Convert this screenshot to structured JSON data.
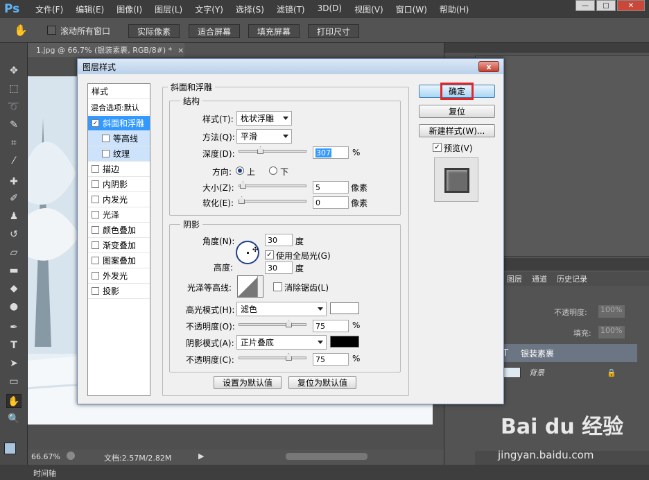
{
  "app": {
    "logo": "Ps"
  },
  "menu": [
    "文件(F)",
    "编辑(E)",
    "图像(I)",
    "图层(L)",
    "文字(Y)",
    "选择(S)",
    "滤镜(T)",
    "3D(D)",
    "视图(V)",
    "窗口(W)",
    "帮助(H)"
  ],
  "window_controls": {
    "minimize": "—",
    "maximize": "□",
    "close": "✕"
  },
  "options": {
    "scroll_all_label": "滚动所有窗口",
    "actual_pixels": "实际像素",
    "fit_screen": "适合屏幕",
    "fill_screen": "填充屏幕",
    "print_size": "打印尺寸"
  },
  "document": {
    "tab_title": "1.jpg @ 66.7% (银装素裹, RGB/8#) *",
    "tab_close": "×"
  },
  "status": {
    "zoom": "66.67%",
    "doc_info": "文档:2.57M/2.82M"
  },
  "timeline": {
    "label": "时间轴"
  },
  "layers_panel": {
    "tabs": [
      "图层",
      "通道",
      "历史记录"
    ],
    "opacity_label": "不透明度:",
    "opacity_value": "100%",
    "fill_label": "填充:",
    "fill_value": "100%",
    "layers": [
      {
        "name": "银装素裹",
        "type": "T"
      },
      {
        "name": "背景",
        "type": "image"
      }
    ]
  },
  "dialog": {
    "title": "图层样式",
    "close": "x",
    "styles_header": "样式",
    "blend_options": "混合选项:默认",
    "styles": [
      {
        "label": "斜面和浮雕",
        "checked": true,
        "state": "selected"
      },
      {
        "label": "等高线",
        "checked": false,
        "state": "sub"
      },
      {
        "label": "纹理",
        "checked": false,
        "state": "sub"
      },
      {
        "label": "描边",
        "checked": false
      },
      {
        "label": "内阴影",
        "checked": false
      },
      {
        "label": "内发光",
        "checked": false
      },
      {
        "label": "光泽",
        "checked": false
      },
      {
        "label": "颜色叠加",
        "checked": false
      },
      {
        "label": "渐变叠加",
        "checked": false
      },
      {
        "label": "图案叠加",
        "checked": false
      },
      {
        "label": "外发光",
        "checked": false
      },
      {
        "label": "投影",
        "checked": false
      }
    ],
    "bevel": {
      "section": "斜面和浮雕",
      "structure": "结构",
      "style_label": "样式(T):",
      "style_value": "枕状浮雕",
      "method_label": "方法(Q):",
      "method_value": "平滑",
      "depth_label": "深度(D):",
      "depth_value": "307",
      "depth_unit": "%",
      "depth_fraction": 0.3,
      "direction_label": "方向:",
      "dir_up": "上",
      "dir_down": "下",
      "size_label": "大小(Z):",
      "size_value": "5",
      "size_unit": "像素",
      "size_fraction": 0.02,
      "soften_label": "软化(E):",
      "soften_value": "0",
      "soften_unit": "像素",
      "soften_fraction": 0.0
    },
    "shading": {
      "section": "阴影",
      "angle_label": "角度(N):",
      "angle_value": "30",
      "angle_unit": "度",
      "global_light": "使用全局光(G)",
      "altitude_label": "高度:",
      "altitude_value": "30",
      "altitude_unit": "度",
      "gloss_label": "光泽等高线:",
      "antialias": "消除锯齿(L)",
      "highlight_label": "高光模式(H):",
      "highlight_value": "滤色",
      "highlight_color": "#ffffff",
      "hl_opacity_label": "不透明度(O):",
      "hl_opacity_value": "75",
      "hl_opacity_fraction": 0.75,
      "shadow_label": "阴影模式(A):",
      "shadow_value": "正片叠底",
      "shadow_color": "#000000",
      "sh_opacity_label": "不透明度(C):",
      "sh_opacity_value": "75",
      "sh_opacity_fraction": 0.75,
      "pct": "%"
    },
    "make_default": "设置为默认值",
    "reset_default": "复位为默认值",
    "ok": "确定",
    "reset": "复位",
    "new_style": "新建样式(W)...",
    "preview": "预览(V)"
  },
  "watermark": {
    "brand": "Bai du 经验",
    "url": "jingyan.baidu.com"
  }
}
